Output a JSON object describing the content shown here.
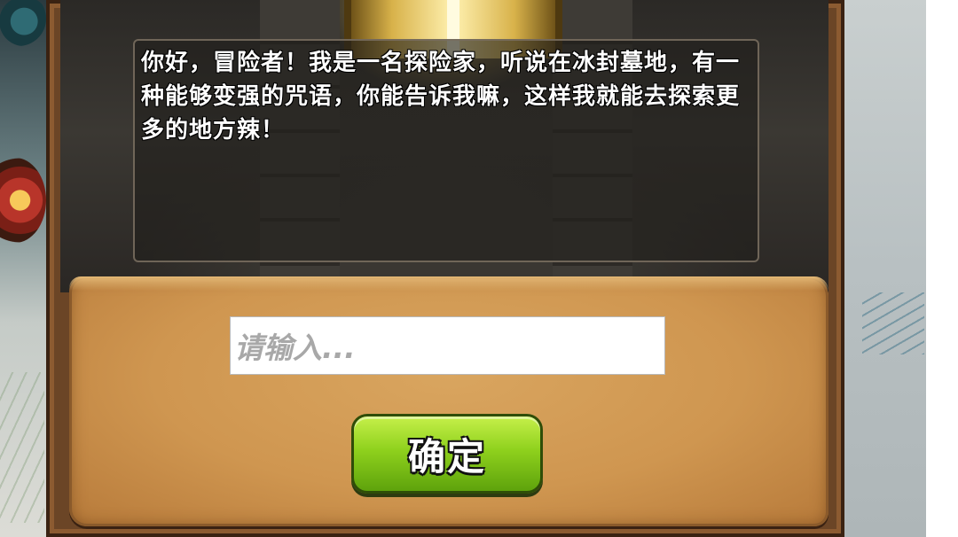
{
  "dialog": {
    "text": "你好，冒险者！我是一名探险家，听说在冰封墓地，有一种能够变强的咒语，你能告诉我嘛，这样我就能去探索更多的地方辣！"
  },
  "spell_input": {
    "placeholder": "请输入..."
  },
  "confirm_button": {
    "label": "确定"
  },
  "colors": {
    "frame": "#6b4526",
    "parchment": "#d9a55f",
    "button": "#8fd11d",
    "text": "#ffffff"
  }
}
